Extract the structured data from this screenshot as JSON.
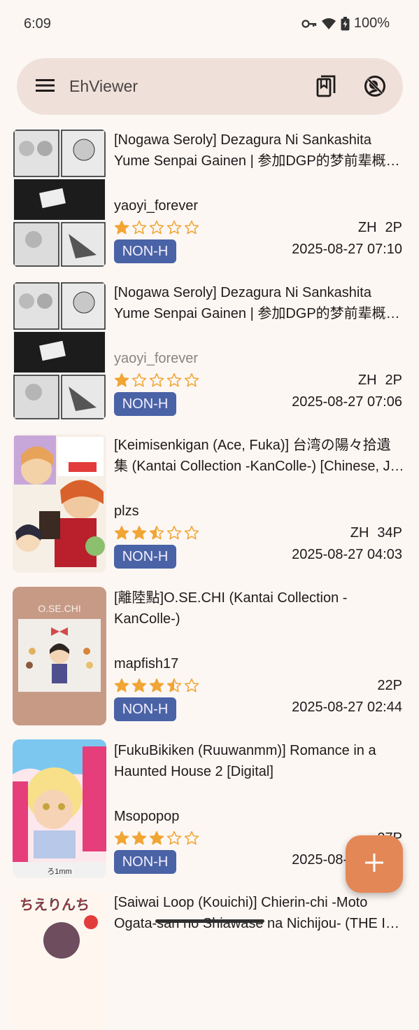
{
  "status_bar": {
    "time": "6:09",
    "battery": "100%",
    "icons": [
      "vpn-key-icon",
      "wifi-icon",
      "battery-charging-icon"
    ]
  },
  "search_bar": {
    "title": "EhViewer",
    "icons": [
      "menu-icon",
      "bookmark-icon",
      "block-icon"
    ]
  },
  "galleries": [
    {
      "title": "[Nogawa Seroly] Dezagura Ni Sankashita Yume Senpai Gainen | 参加DGP的梦前辈概…",
      "uploader": "yaoyi_forever",
      "rating": 1,
      "language": "ZH",
      "pages": "2P",
      "category": "NON-H",
      "date": "2025-08-27 07:10",
      "thumb": "manga-panels"
    },
    {
      "title": "[Nogawa Seroly] Dezagura Ni Sankashita Yume Senpai Gainen | 参加DGP的梦前辈概…",
      "uploader": "yaoyi_forever",
      "uploader_disowned": true,
      "rating": 1,
      "language": "ZH",
      "pages": "2P",
      "category": "NON-H",
      "date": "2025-08-27 07:06",
      "thumb": "manga-panels"
    },
    {
      "title": "[Keimisenkigan (Ace, Fuka)] 台湾の陽々拾遺集 (Kantai Collection -KanColle-) [Chinese, J…",
      "uploader": "plzs",
      "rating": 2.5,
      "language": "ZH",
      "pages": "34P",
      "category": "NON-H",
      "date": "2025-08-27 04:03",
      "thumb": "colorful-cover"
    },
    {
      "title": "[離陸點]O.SE.CHI (Kantai Collection -KanColle-)",
      "uploader": "mapfish17",
      "rating": 3.5,
      "language": "",
      "pages": "22P",
      "category": "NON-H",
      "date": "2025-08-27 02:44",
      "thumb": "osechi-cover",
      "thumb_text": "O.SE.CHI"
    },
    {
      "title": "[FukuBikiken (Ruuwanmm)] Romance in a Haunted House 2 [Digital]",
      "uploader": "Msopopop",
      "rating": 3,
      "language": "",
      "pages": "27P",
      "category": "NON-H",
      "date": "2025-08-27 01:26",
      "thumb": "blonde-cover",
      "thumb_text": "ろ1mm"
    },
    {
      "title": "[Saiwai Loop (Kouichi)] Chierin-chi -Moto Ogata-san no Shiawase na Nichijou- (THE I…",
      "uploader": "",
      "rating": 0,
      "language": "",
      "pages": "",
      "category": "",
      "date": "",
      "thumb": "chierin-cover",
      "thumb_text": "ちえりんち"
    }
  ],
  "fab": {
    "icon": "plus-icon"
  },
  "colors": {
    "accent": "#e38756",
    "category_nonh": "#4a63a6",
    "star": "#f0a534",
    "background": "#fdf7f4",
    "search_bar": "#efe1da"
  }
}
